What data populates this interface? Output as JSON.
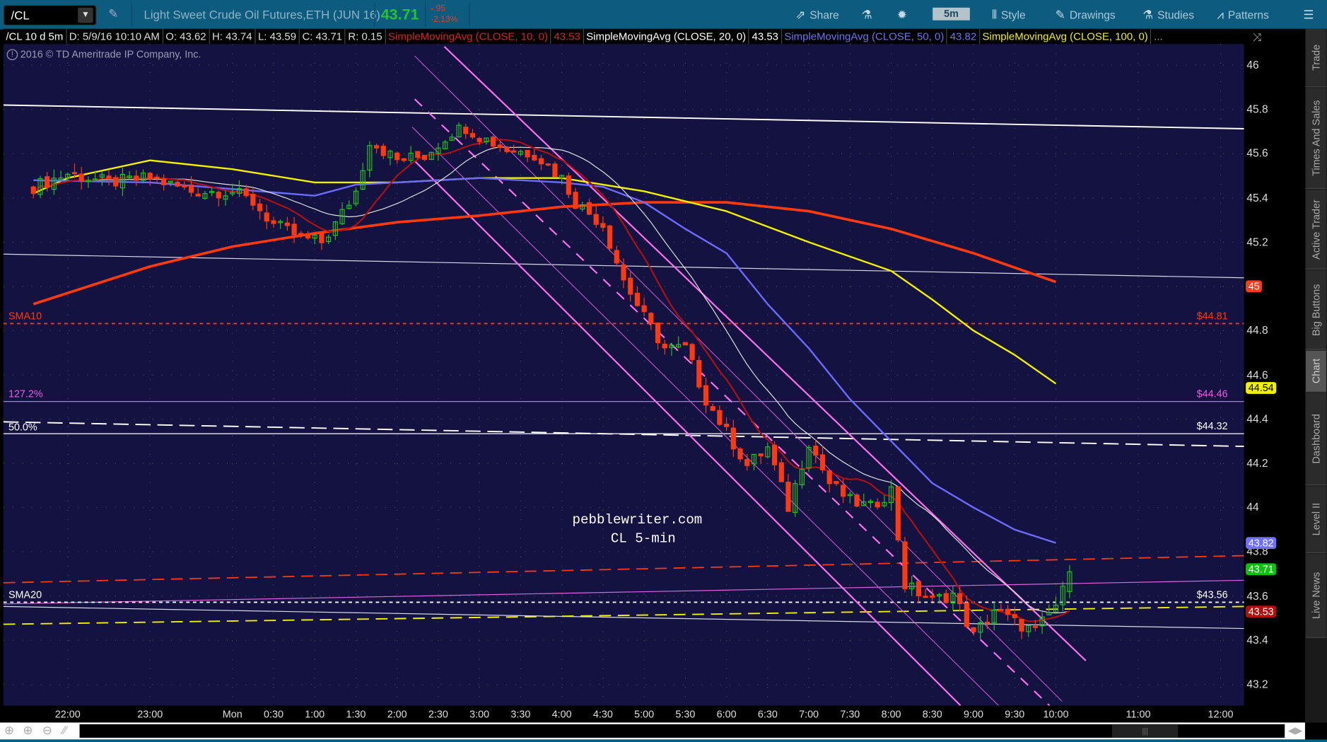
{
  "toolbar": {
    "symbol": "/CL",
    "dropdown_icon": "▼",
    "description": "Light Sweet Crude Oil Futures,ETH (JUN 16)",
    "last": "43.71",
    "change": "-.95",
    "change_pct": "-2.13%",
    "share": "Share",
    "timeframe": "5m",
    "style": "Style",
    "drawings": "Drawings",
    "studies": "Studies",
    "patterns": "Patterns"
  },
  "info_bar": {
    "symbol_period": "/CL 10 d 5m",
    "date": "D: 5/9/16 10:10 AM",
    "open": "O: 43.62",
    "high": "H: 43.74",
    "low": "L: 43.59",
    "close": "C: 43.71",
    "range": "R: 0.15",
    "studies": [
      {
        "label": "SimpleMovingAvg (CLOSE, 10, 0)",
        "value": "43.53",
        "color": "#e0201a"
      },
      {
        "label": "SimpleMovingAvg (CLOSE, 20, 0)",
        "value": "43.53",
        "color": "#ffffff"
      },
      {
        "label": "SimpleMovingAvg (CLOSE, 50, 0)",
        "value": "43.82",
        "color": "#7070ff"
      },
      {
        "label": "SimpleMovingAvg (CLOSE, 100, 0)",
        "value": "",
        "color": "#f0f000"
      }
    ],
    "more": "..."
  },
  "copyright": "2016 © TD Ameritrade IP Company, Inc.",
  "watermark": {
    "line1": "pebblewriter.com",
    "line2": "CL 5-min"
  },
  "annotations": {
    "sma10_label": "SMA10",
    "sma10_price": "$44.81",
    "fib_1272_label": "127.2%",
    "fib_1272_price": "$44.46",
    "fib_50_label": "50.0%",
    "level_price": "$44.32",
    "sma20_label": "SMA20",
    "sma20_price": "$43.56"
  },
  "price_axis": [
    "46",
    "45.8",
    "45.6",
    "45.4",
    "45.2",
    "45",
    "44.8",
    "44.6",
    "44.4",
    "44.2",
    "44",
    "43.8",
    "43.6",
    "43.4",
    "43.2"
  ],
  "price_badges": [
    {
      "label": "45",
      "price": 45.0,
      "bg": "#ff3b1f",
      "fg": "#ffffff"
    },
    {
      "label": "44.54",
      "price": 44.54,
      "bg": "#f0f000",
      "fg": "#000000"
    },
    {
      "label": "43.82",
      "price": 43.84,
      "bg": "#7070ff",
      "fg": "#ffffff"
    },
    {
      "label": "43.71",
      "price": 43.72,
      "bg": "#10c010",
      "fg": "#ffffff"
    },
    {
      "label": "43.53",
      "price": 43.53,
      "bg": "#b01010",
      "fg": "#ffffff"
    }
  ],
  "time_axis": [
    {
      "label": "22:00",
      "t": "22:00"
    },
    {
      "label": "23:00",
      "t": "23:00"
    },
    {
      "label": "Mon",
      "t": "00:00"
    },
    {
      "label": "0:30",
      "t": "00:30"
    },
    {
      "label": "1:00",
      "t": "01:00"
    },
    {
      "label": "1:30",
      "t": "01:30"
    },
    {
      "label": "2:00",
      "t": "02:00"
    },
    {
      "label": "2:30",
      "t": "02:30"
    },
    {
      "label": "3:00",
      "t": "03:00"
    },
    {
      "label": "3:30",
      "t": "03:30"
    },
    {
      "label": "4:00",
      "t": "04:00"
    },
    {
      "label": "4:30",
      "t": "04:30"
    },
    {
      "label": "5:00",
      "t": "05:00"
    },
    {
      "label": "5:30",
      "t": "05:30"
    },
    {
      "label": "6:00",
      "t": "06:00"
    },
    {
      "label": "6:30",
      "t": "06:30"
    },
    {
      "label": "7:00",
      "t": "07:00"
    },
    {
      "label": "7:30",
      "t": "07:30"
    },
    {
      "label": "8:00",
      "t": "08:00"
    },
    {
      "label": "8:30",
      "t": "08:30"
    },
    {
      "label": "9:00",
      "t": "09:00"
    },
    {
      "label": "9:30",
      "t": "09:30"
    },
    {
      "label": "10:00",
      "t": "10:00"
    },
    {
      "label": "11:00",
      "t": "11:00"
    },
    {
      "label": "12:00",
      "t": "12:00"
    }
  ],
  "sidebar_tabs": [
    "Trade",
    "Times And Sales",
    "Active Trader",
    "Big Buttons",
    "Chart",
    "Dashboard",
    "Level II",
    "Live News"
  ],
  "active_tab": "Chart",
  "colors": {
    "up": "#1fc01f",
    "down": "#ff3a10",
    "sma10": "#b01010",
    "sma20": "#e0e0e0",
    "sma50": "#6b6bff",
    "sma100": "#f0f000",
    "sma_long": "#ff3a10"
  },
  "chart_data": {
    "type": "candlestick",
    "interval": "5m",
    "ylim": [
      43.1,
      46.1
    ],
    "close_path": [
      [
        "21:35",
        45.45
      ],
      [
        "22:00",
        45.51
      ],
      [
        "22:30",
        45.47
      ],
      [
        "23:00",
        45.49
      ],
      [
        "23:30",
        45.43
      ],
      [
        "00:00",
        45.43
      ],
      [
        "00:15",
        45.38
      ],
      [
        "00:30",
        45.28
      ],
      [
        "00:50",
        45.22
      ],
      [
        "01:05",
        45.2
      ],
      [
        "01:15",
        45.28
      ],
      [
        "01:30",
        45.43
      ],
      [
        "01:40",
        45.66
      ],
      [
        "02:00",
        45.57
      ],
      [
        "02:20",
        45.59
      ],
      [
        "02:40",
        45.7
      ],
      [
        "02:50",
        45.72
      ],
      [
        "03:00",
        45.68
      ],
      [
        "03:20",
        45.62
      ],
      [
        "03:40",
        45.6
      ],
      [
        "04:00",
        45.49
      ],
      [
        "04:10",
        45.38
      ],
      [
        "04:30",
        45.28
      ],
      [
        "04:45",
        45.03
      ],
      [
        "05:00",
        44.86
      ],
      [
        "05:15",
        44.72
      ],
      [
        "05:30",
        44.72
      ],
      [
        "05:45",
        44.49
      ],
      [
        "06:00",
        44.34
      ],
      [
        "06:15",
        44.19
      ],
      [
        "06:30",
        44.27
      ],
      [
        "06:45",
        44.0
      ],
      [
        "07:00",
        44.3
      ],
      [
        "07:15",
        44.11
      ],
      [
        "07:30",
        44.03
      ],
      [
        "07:45",
        44.0
      ],
      [
        "08:00",
        44.08
      ],
      [
        "08:10",
        43.65
      ],
      [
        "08:30",
        43.58
      ],
      [
        "08:45",
        43.61
      ],
      [
        "09:00",
        43.42
      ],
      [
        "09:15",
        43.54
      ],
      [
        "09:30",
        43.48
      ],
      [
        "09:45",
        43.44
      ],
      [
        "10:00",
        43.56
      ],
      [
        "10:05",
        43.62
      ]
    ],
    "last_bar": {
      "t": "10:10",
      "open": 43.62,
      "high": 43.74,
      "low": 43.59,
      "close": 43.71
    },
    "sma100": [
      [
        "21:35",
        45.42
      ],
      [
        "22:00",
        45.49
      ],
      [
        "23:00",
        45.57
      ],
      [
        "00:00",
        45.53
      ],
      [
        "01:00",
        45.47
      ],
      [
        "02:00",
        45.47
      ],
      [
        "03:00",
        45.49
      ],
      [
        "04:00",
        45.49
      ],
      [
        "05:00",
        45.43
      ],
      [
        "06:00",
        45.34
      ],
      [
        "07:00",
        45.2
      ],
      [
        "08:00",
        45.07
      ],
      [
        "08:30",
        44.94
      ],
      [
        "09:00",
        44.8
      ],
      [
        "09:30",
        44.69
      ],
      [
        "10:00",
        44.56
      ]
    ],
    "sma50": [
      [
        "21:35",
        45.48
      ],
      [
        "23:00",
        45.47
      ],
      [
        "00:00",
        45.44
      ],
      [
        "01:00",
        45.41
      ],
      [
        "01:30",
        45.46
      ],
      [
        "02:00",
        45.47
      ],
      [
        "03:00",
        45.49
      ],
      [
        "04:00",
        45.47
      ],
      [
        "04:30",
        45.45
      ],
      [
        "05:00",
        45.38
      ],
      [
        "05:30",
        45.26
      ],
      [
        "06:00",
        45.15
      ],
      [
        "06:30",
        44.92
      ],
      [
        "07:00",
        44.72
      ],
      [
        "07:30",
        44.49
      ],
      [
        "08:00",
        44.3
      ],
      [
        "08:30",
        44.11
      ],
      [
        "09:00",
        44.0
      ],
      [
        "09:30",
        43.9
      ],
      [
        "10:00",
        43.84
      ]
    ],
    "sma_long": [
      [
        "21:35",
        44.92
      ],
      [
        "22:00",
        44.97
      ],
      [
        "23:00",
        45.09
      ],
      [
        "00:00",
        45.18
      ],
      [
        "01:00",
        45.24
      ],
      [
        "02:00",
        45.29
      ],
      [
        "03:00",
        45.32
      ],
      [
        "04:00",
        45.36
      ],
      [
        "05:00",
        45.38
      ],
      [
        "06:00",
        45.38
      ],
      [
        "07:00",
        45.34
      ],
      [
        "08:00",
        45.26
      ],
      [
        "09:00",
        45.15
      ],
      [
        "10:00",
        45.02
      ]
    ]
  }
}
